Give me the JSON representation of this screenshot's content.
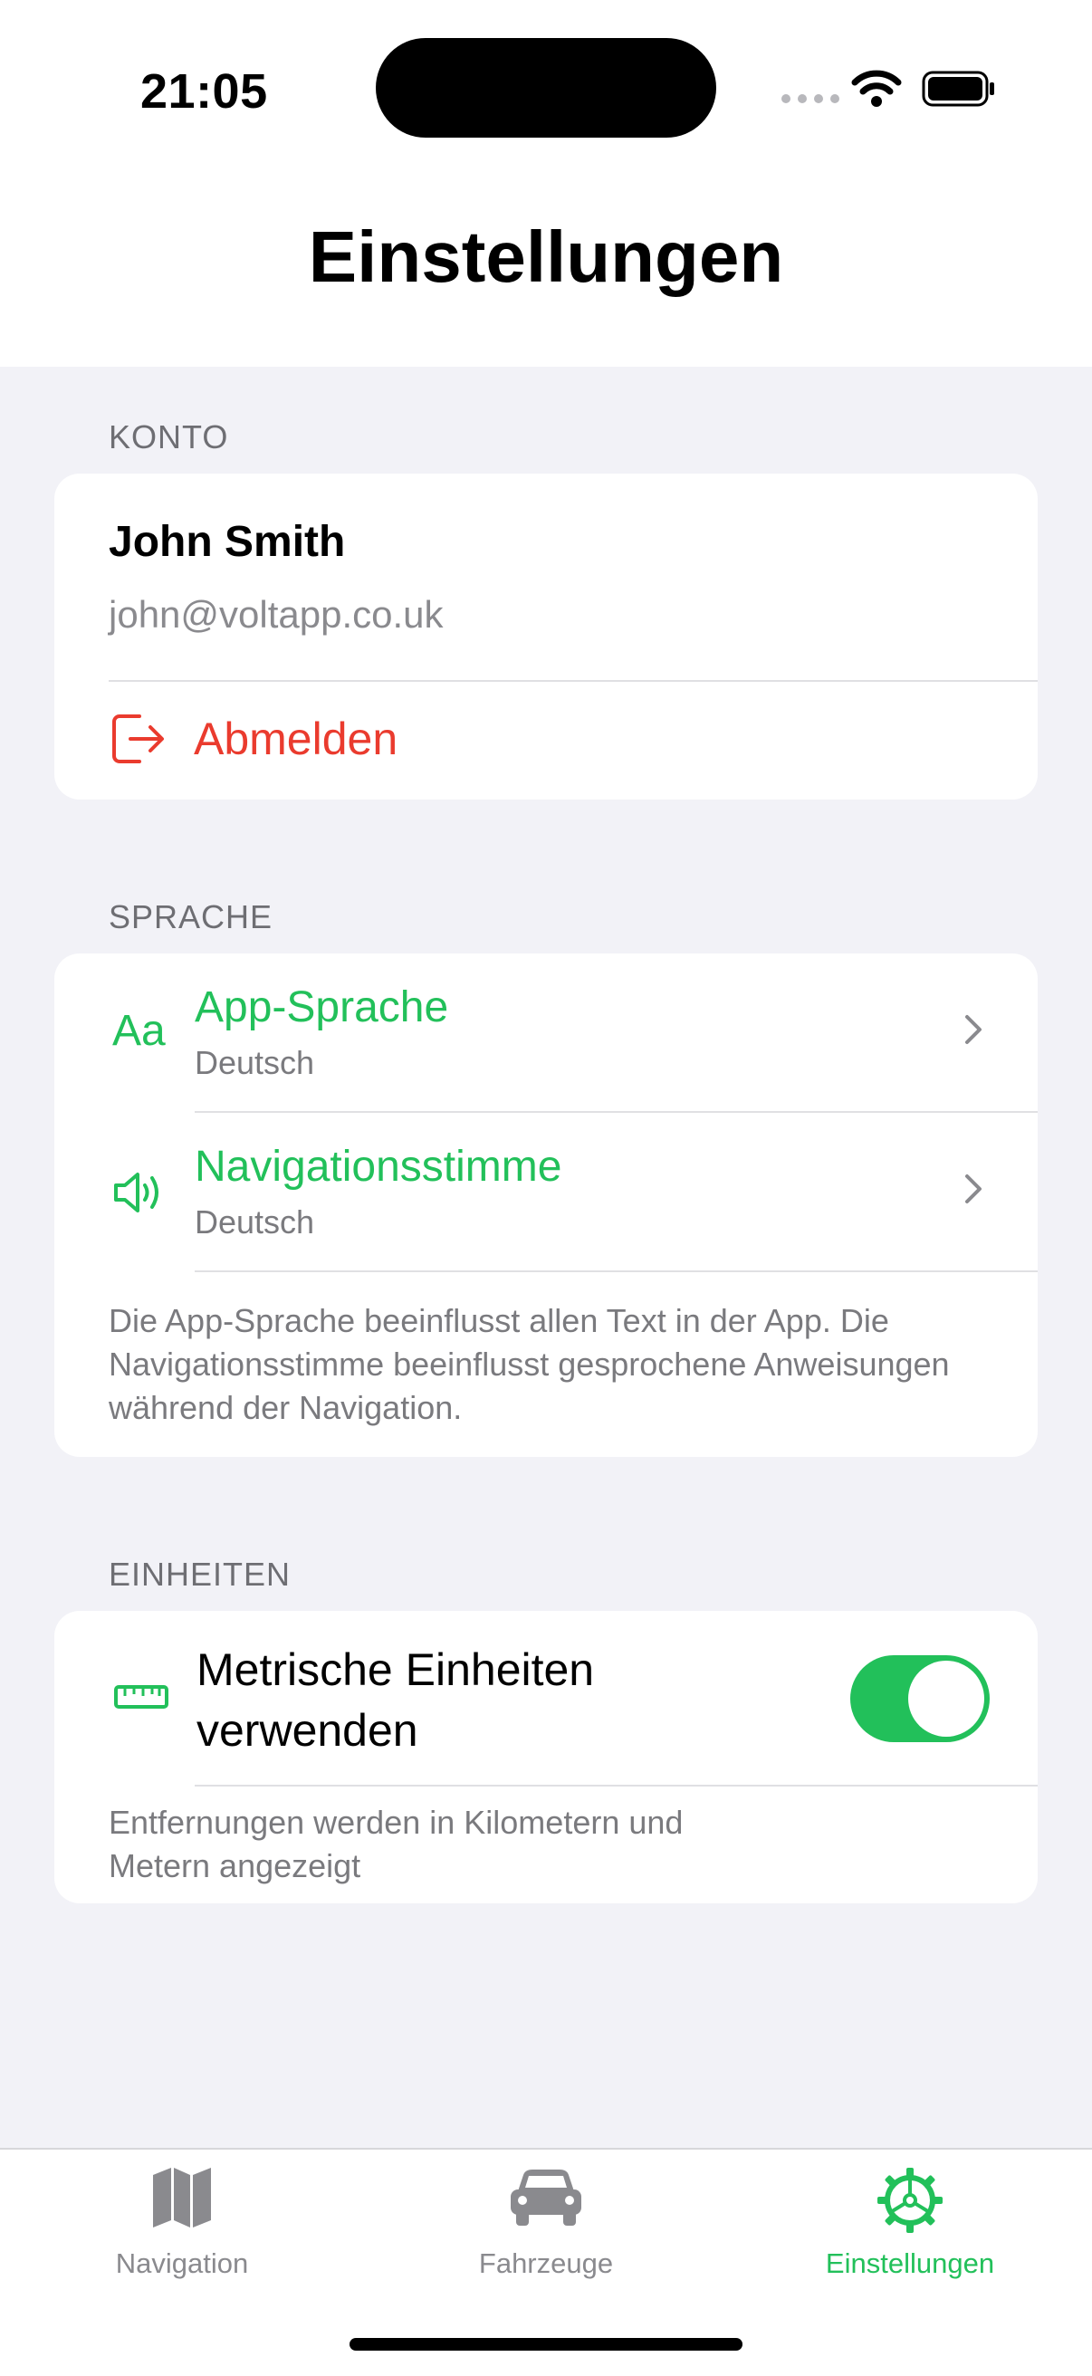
{
  "status": {
    "time": "21:05"
  },
  "page": {
    "title": "Einstellungen"
  },
  "account": {
    "section_label": "KONTO",
    "name": "John Smith",
    "email": "john@voltapp.co.uk",
    "logout_label": "Abmelden"
  },
  "language": {
    "section_label": "SPRACHE",
    "items": [
      {
        "title": "App-Sprache",
        "value": "Deutsch"
      },
      {
        "title": "Navigationsstimme",
        "value": "Deutsch"
      }
    ],
    "note": "Die App-Sprache beeinflusst allen Text in der App. Die Navigationsstimme beeinflusst gesprochene Anweisungen während der Navigation."
  },
  "units": {
    "section_label": "EINHEITEN",
    "metric_label": "Metrische Einheiten verwenden",
    "metric_enabled": true,
    "note": "Entfernungen werden in Kilometern und Metern angezeigt"
  },
  "tabs": [
    {
      "label": "Navigation",
      "icon": "map-icon",
      "active": false
    },
    {
      "label": "Fahrzeuge",
      "icon": "car-icon",
      "active": false
    },
    {
      "label": "Einstellungen",
      "icon": "gear-icon",
      "active": true
    }
  ],
  "colors": {
    "accent": "#22c05a",
    "destructive": "#ea3b2e",
    "background": "#f2f2f7"
  }
}
